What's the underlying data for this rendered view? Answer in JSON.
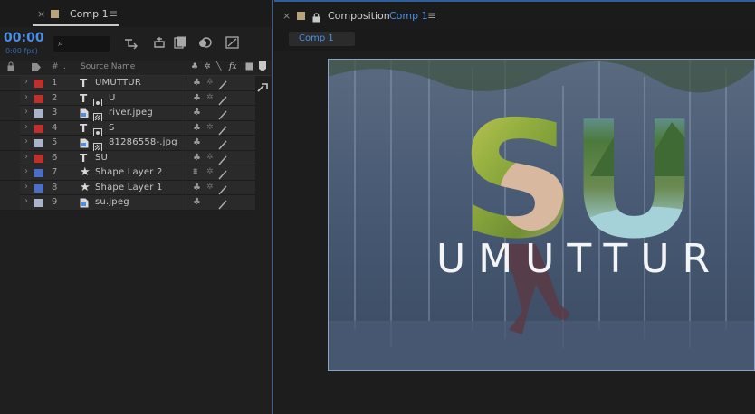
{
  "timeline": {
    "tab": {
      "close": "×",
      "label": "Comp 1",
      "menu": "≡",
      "swatch_color": "#b8a37a"
    },
    "timecode": "00:00",
    "fps": "0:00 fps)",
    "search_glyph": "⌕",
    "columns": {
      "num": "#",
      "dot": ".",
      "source_name": "Source Name",
      "switches": "fx"
    },
    "layers": [
      {
        "num": "1",
        "type": "text",
        "name": "UMUTTUR",
        "label_color": "#c0302a",
        "switch_a": "♣",
        "switch_b": "✲"
      },
      {
        "num": "2",
        "type": "text-mask",
        "name": "U",
        "label_color": "#c0302a",
        "switch_a": "♣",
        "switch_b": "✲"
      },
      {
        "num": "3",
        "type": "footage",
        "name": "river.jpeg",
        "label_color": "#a9b3c9",
        "switch_a": "♣",
        "switch_b": ""
      },
      {
        "num": "4",
        "type": "text-mask",
        "name": "S",
        "label_color": "#c0302a",
        "switch_a": "♣",
        "switch_b": "✲"
      },
      {
        "num": "5",
        "type": "footage",
        "name": "81286558-.jpg",
        "label_color": "#a9b3c9",
        "switch_a": "♣",
        "switch_b": ""
      },
      {
        "num": "6",
        "type": "text",
        "name": "SU",
        "label_color": "#c0302a",
        "switch_a": "♣",
        "switch_b": "✲"
      },
      {
        "num": "7",
        "type": "shape",
        "name": "Shape Layer 2",
        "label_color": "#4b6fc8",
        "switch_a": "⩩",
        "switch_b": "✲"
      },
      {
        "num": "8",
        "type": "shape",
        "name": "Shape Layer 1",
        "label_color": "#4b6fc8",
        "switch_a": "♣",
        "switch_b": "✲"
      },
      {
        "num": "9",
        "type": "footage-plain",
        "name": "su.jpeg",
        "label_color": "#a9b3c9",
        "switch_a": "♣",
        "switch_b": ""
      }
    ]
  },
  "composition": {
    "tab": {
      "close": "×",
      "lock": "🔒",
      "label_prefix": "Composition",
      "label_comp": "Comp 1",
      "menu": "≡",
      "swatch_color": "#b8a37a"
    },
    "breadcrumb": "Comp 1",
    "preview": {
      "big_text": "SU",
      "title": "UMUTTUR"
    }
  },
  "colors": {
    "accent_blue": "#4a8fe8",
    "panel_dark": "#1e1e1e",
    "row_bg": "#2a2a2a"
  }
}
